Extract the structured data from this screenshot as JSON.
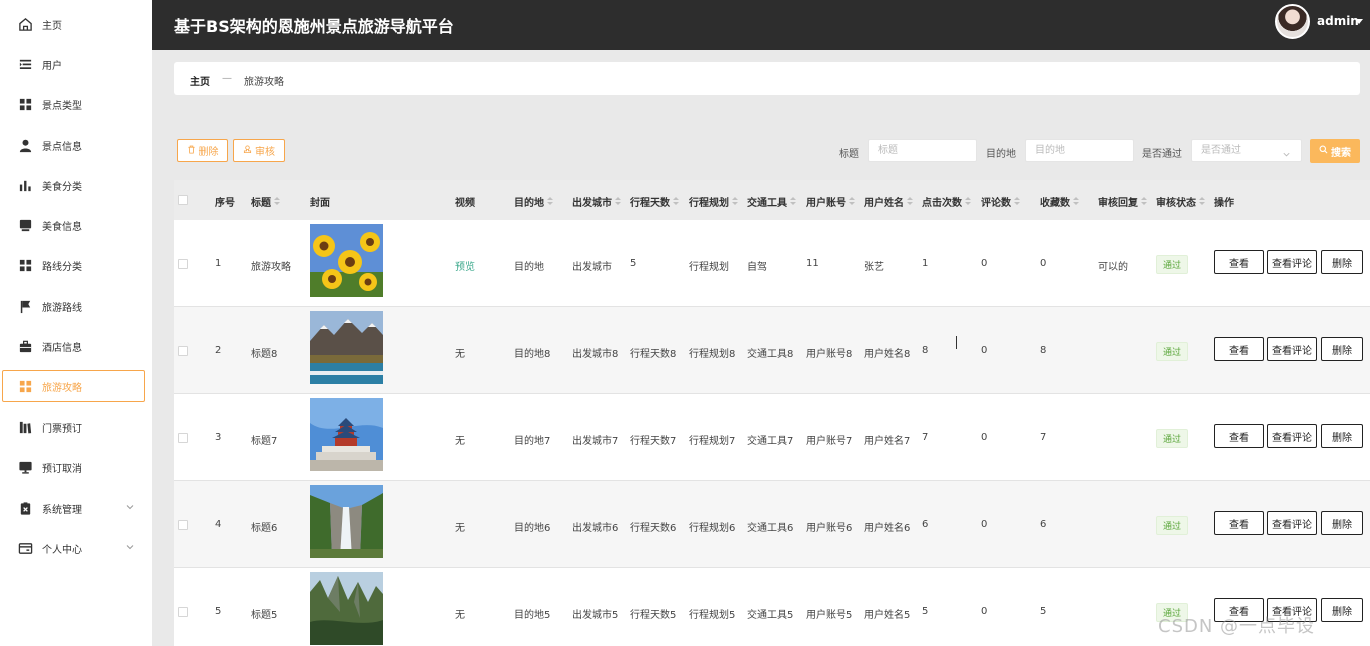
{
  "app": {
    "title": "基于BS架构的恩施州景点旅游导航平台",
    "user_name": "admin"
  },
  "colors": {
    "accent": "#f7a64b",
    "topbar": "#2d2d2d",
    "search_button": "#fbb85c",
    "status_green": "#5aa63a"
  },
  "sidebar": {
    "items": [
      {
        "label": "主页",
        "icon": "home-icon"
      },
      {
        "label": "用户",
        "icon": "list-icon"
      },
      {
        "label": "景点类型",
        "icon": "grid-icon"
      },
      {
        "label": "景点信息",
        "icon": "person-icon"
      },
      {
        "label": "美食分类",
        "icon": "bar-chart-icon"
      },
      {
        "label": "美食信息",
        "icon": "tray-icon"
      },
      {
        "label": "路线分类",
        "icon": "grid-icon"
      },
      {
        "label": "旅游路线",
        "icon": "flag-icon"
      },
      {
        "label": "酒店信息",
        "icon": "briefcase-icon"
      },
      {
        "label": "旅游攻略",
        "icon": "grid-icon"
      },
      {
        "label": "门票预订",
        "icon": "books-icon"
      },
      {
        "label": "预订取消",
        "icon": "monitor-icon"
      },
      {
        "label": "系统管理",
        "icon": "clipboard-x-icon"
      },
      {
        "label": "个人中心",
        "icon": "card-icon"
      }
    ]
  },
  "breadcrumb": {
    "home": "主页",
    "separator": "—",
    "current": "旅游攻略"
  },
  "toolbar": {
    "delete_label": "删除",
    "audit_label": "审核",
    "search_label": "搜索"
  },
  "filters": {
    "title_label": "标题",
    "title_placeholder": "标题",
    "dest_label": "目的地",
    "dest_placeholder": "目的地",
    "approved_label": "是否通过",
    "approved_placeholder": "是否通过"
  },
  "table": {
    "headers": {
      "index": "序号",
      "title": "标题",
      "cover": "封面",
      "video": "视频",
      "dest": "目的地",
      "city": "出发城市",
      "days": "行程天数",
      "plan": "行程规划",
      "transport": "交通工具",
      "account": "用户账号",
      "name": "用户姓名",
      "clicks": "点击次数",
      "comments": "评论数",
      "favorites": "收藏数",
      "reply": "审核回复",
      "status": "审核状态",
      "actions": "操作"
    },
    "actions": {
      "view": "查看",
      "view_comments": "查看评论",
      "delete": "删除"
    },
    "rows": [
      {
        "index": "1",
        "title": "旅游攻略",
        "cover": "sunflowers",
        "video": "预览",
        "dest": "目的地",
        "city": "出发城市",
        "days": "5",
        "plan": "行程规划",
        "transport": "自驾",
        "account": "11",
        "name": "张艺",
        "clicks": "1",
        "comments": "0",
        "favorites": "0",
        "reply": "可以的",
        "status": "通过"
      },
      {
        "index": "2",
        "title": "标题8",
        "cover": "mountain-lake",
        "video": "无",
        "dest": "目的地8",
        "city": "出发城市8",
        "days": "行程天数8",
        "plan": "行程规划8",
        "transport": "交通工具8",
        "account": "用户账号8",
        "name": "用户姓名8",
        "clicks": "8",
        "comments": "0",
        "favorites": "8",
        "reply": "",
        "status": "通过"
      },
      {
        "index": "3",
        "title": "标题7",
        "cover": "temple-of-heaven",
        "video": "无",
        "dest": "目的地7",
        "city": "出发城市7",
        "days": "行程天数7",
        "plan": "行程规划7",
        "transport": "交通工具7",
        "account": "用户账号7",
        "name": "用户姓名7",
        "clicks": "7",
        "comments": "0",
        "favorites": "7",
        "reply": "",
        "status": "通过"
      },
      {
        "index": "4",
        "title": "标题6",
        "cover": "waterfall-canyon",
        "video": "无",
        "dest": "目的地6",
        "city": "出发城市6",
        "days": "行程天数6",
        "plan": "行程规划6",
        "transport": "交通工具6",
        "account": "用户账号6",
        "name": "用户姓名6",
        "clicks": "6",
        "comments": "0",
        "favorites": "6",
        "reply": "",
        "status": "通过"
      },
      {
        "index": "5",
        "title": "标题5",
        "cover": "green-peaks",
        "video": "无",
        "dest": "目的地5",
        "city": "出发城市5",
        "days": "行程天数5",
        "plan": "行程规划5",
        "transport": "交通工具5",
        "account": "用户账号5",
        "name": "用户姓名5",
        "clicks": "5",
        "comments": "0",
        "favorites": "5",
        "reply": "",
        "status": "通过"
      }
    ]
  },
  "watermark": "CSDN @一点毕设"
}
